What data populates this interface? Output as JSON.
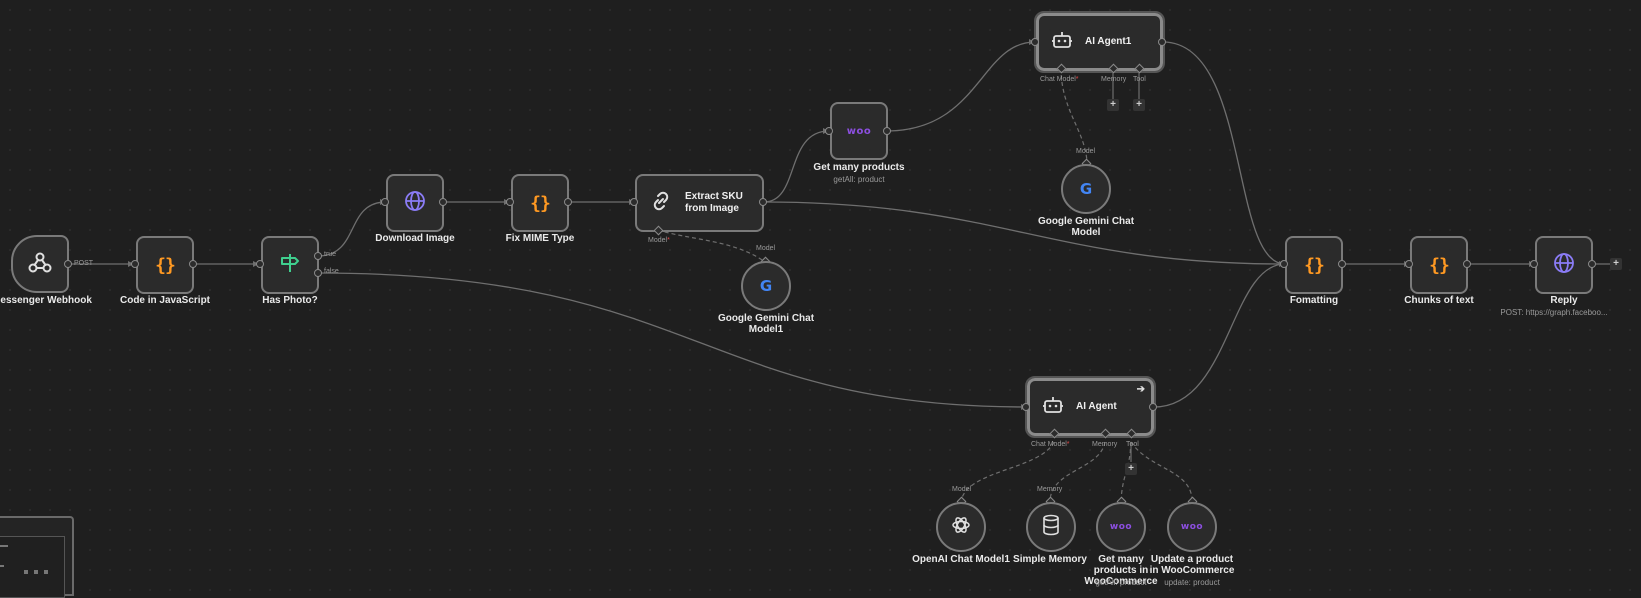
{
  "canvas": {
    "colors": {
      "background": "#1f1f1f",
      "wire": "#6f6f6f",
      "code_icon": "#ff9922",
      "router_icon": "#3fcf8e",
      "http_icon": "#8b7cf6",
      "woo": "#8c4fe0",
      "required": "#e14848"
    }
  },
  "nodes": {
    "webhook": {
      "title": "Messenger Webhook",
      "port_label": "POST",
      "icon": "webhook-icon"
    },
    "code_js": {
      "title": "Code in JavaScript",
      "icon": "code-braces-icon"
    },
    "has_photo": {
      "title": "Has Photo?",
      "true_label": "true",
      "false_label": "false",
      "icon": "signpost-icon"
    },
    "download_image": {
      "title": "Download Image",
      "icon": "globe-icon"
    },
    "fix_mime": {
      "title": "Fix MIME Type",
      "icon": "code-braces-icon"
    },
    "extract_sku": {
      "title": "Extract SKU from Image",
      "model_label": "Model",
      "icon": "link-icon"
    },
    "gemini1": {
      "title": "Google Gemini Chat Model1",
      "port_label": "Model",
      "glyph": "G",
      "icon": "google-icon"
    },
    "get_products": {
      "title": "Get many products",
      "subtitle": "getAll: product",
      "glyph": "woo",
      "icon": "woocommerce-icon"
    },
    "ai_agent1": {
      "title": "AI Agent1",
      "chat_model": "Chat Model",
      "memory": "Memory",
      "tool": "Tool",
      "icon": "robot-icon"
    },
    "gemini": {
      "title": "Google Gemini Chat Model",
      "port_label": "Model",
      "glyph": "G",
      "icon": "google-icon"
    },
    "formatting": {
      "title": "Fomatting",
      "icon": "code-braces-icon"
    },
    "chunks": {
      "title": "Chunks of text",
      "icon": "code-braces-icon"
    },
    "reply": {
      "title": "Reply",
      "subtitle": "POST: https://graph.faceboo...",
      "icon": "globe-icon"
    },
    "ai_agent": {
      "title": "AI Agent",
      "chat_model": "Chat Model",
      "memory": "Memory",
      "tool": "Tool",
      "icon": "robot-icon"
    },
    "openai": {
      "title": "OpenAI Chat Model1",
      "port_label": "Model",
      "icon": "openai-icon"
    },
    "simple_memory": {
      "title": "Simple Memory",
      "port_label": "Memory",
      "icon": "database-icon"
    },
    "woo_get": {
      "title": "Get many products in WooCommerce",
      "subtitle": "getAll: product",
      "glyph": "woo",
      "icon": "woocommerce-icon"
    },
    "woo_update": {
      "title": "Update a product in WooCommerce",
      "subtitle": "update: product",
      "glyph": "woo",
      "icon": "woocommerce-icon"
    }
  },
  "controls": {
    "plus": "+",
    "required_mark": "*"
  }
}
